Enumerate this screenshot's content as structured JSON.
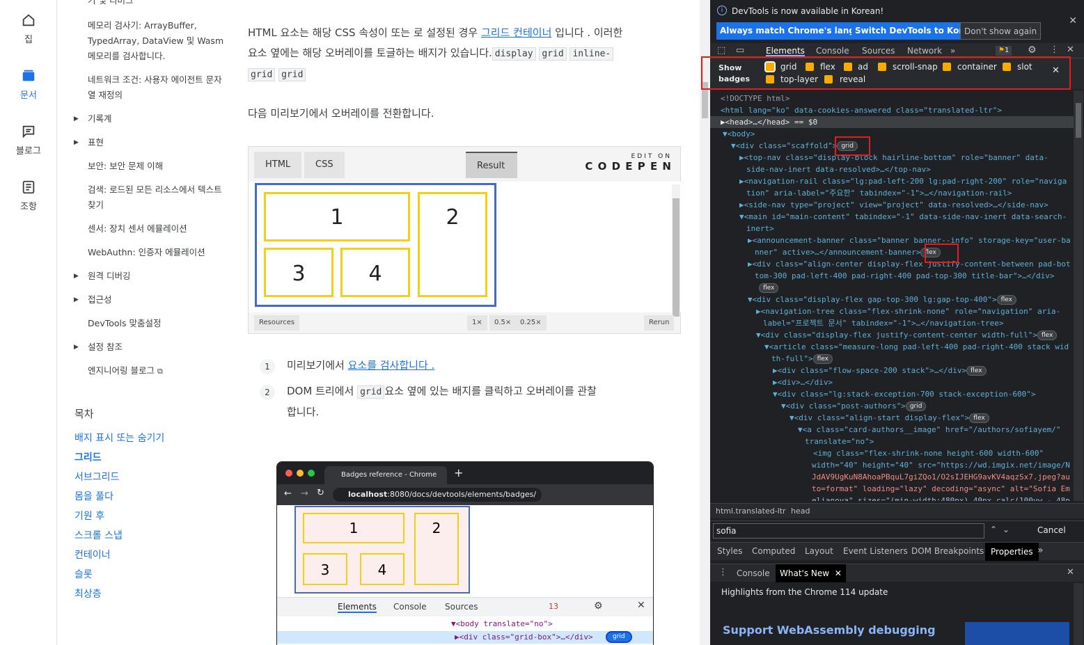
{
  "rail": [
    {
      "label": "집",
      "icon": "home-icon"
    },
    {
      "label": "문서",
      "icon": "docs-icon"
    },
    {
      "label": "블로그",
      "icon": "blog-icon"
    },
    {
      "label": "조항",
      "icon": "articles-icon"
    }
  ],
  "sidebar": {
    "items_top": [
      "기 및 디버그",
      "메모리 검사기: ArrayBuffer, TypedArray, DataView 및 Wasm 메모리를 검사합니다.",
      "네트워크 조건: 사용자 에이전트 문자열 재정의"
    ],
    "items": [
      {
        "label": "기록계",
        "caret": true
      },
      {
        "label": "표현",
        "caret": true
      },
      {
        "label": "보안: 보안 문제 이해",
        "caret": false
      },
      {
        "label": "검색: 로드된 모든 리소스에서 텍스트 찾기",
        "caret": false
      },
      {
        "label": "센서: 장치 센서 에뮬레이션",
        "caret": false
      },
      {
        "label": "WebAuthn: 인증자 에뮬레이션",
        "caret": false
      },
      {
        "label": "원격 디버깅",
        "caret": true
      },
      {
        "label": "접근성",
        "caret": true
      },
      {
        "label": "DevTools 맞춤설정",
        "caret": false
      },
      {
        "label": "설정 참조",
        "caret": true
      },
      {
        "label": "엔지니어링 블로그",
        "caret": false
      }
    ],
    "toc_title": "목차",
    "toc": [
      "배지 표시 또는 숨기기",
      "그리드",
      "서브그리드",
      "몸을 풀다",
      "기원 후",
      "스크롤 스냅",
      "컨테이너",
      "슬롯",
      "최상층"
    ]
  },
  "article": {
    "para1_a": "HTML 요소는 해당 CSS 속성이 또는 로 설정된 경우",
    "para1_link": "그리드 컨테이너",
    "para1_b": "입니다 . 이러한",
    "para2": "요소 옆에는 해당 오버레이를 토글하는 배지가 있습니다.",
    "code_display": "display",
    "code_grid": "grid",
    "code_inline": "inline-",
    "code_inline_grid": "grid",
    "code_grid2": "grid",
    "para3": "다음 미리보기에서 오버레이를 전환합니다.",
    "codepen": {
      "tab_html": "HTML",
      "tab_css": "CSS",
      "tab_result": "Result",
      "edit_on": "EDIT ON",
      "brand": "C O D E P E N",
      "cells": [
        "1",
        "2",
        "3",
        "4"
      ],
      "resources": "Resources",
      "zoom": [
        "1×",
        "0.5×",
        "0.25×"
      ],
      "rerun": "Rerun"
    },
    "step1_num": "1",
    "step1_a": "미리보기에서",
    "step1_link": "요소를 검사합니다 .",
    "step2_num": "2",
    "step2_a": "DOM 트리에서",
    "step2_code": "grid",
    "step2_b": "요소 옆에 있는 배지를 클릭하고 오버레이를 관찰",
    "step2_c": "합니다.",
    "shot": {
      "tab_title": "Badges reference - Chrome De",
      "url_host": "localhost",
      "url_rest": ":8080/docs/devtools/elements/badges/",
      "cells": [
        "1",
        "2",
        "3",
        "4"
      ],
      "dt_tabs": [
        "Elements",
        "Console",
        "Sources"
      ],
      "err_count": "13",
      "line1": "▼<body translate=\"no\">",
      "line2": "▶<div class=\"grid-box\">…</div>",
      "badge": "grid"
    }
  },
  "devtools": {
    "info": "DevTools is now available in Korean!",
    "btn_match": "Always match Chrome's language",
    "btn_switch": "Switch DevTools to Korean",
    "btn_dont": "Don't show again",
    "tabs": [
      "Elements",
      "Console",
      "Sources",
      "Network"
    ],
    "issues_count": "1",
    "show_badges": "Show badges",
    "badges": [
      "grid",
      "flex",
      "ad",
      "scroll-snap",
      "container",
      "slot",
      "top-layer",
      "reveal"
    ],
    "dom": [
      "<!DOCTYPE html>",
      "<html lang=\"ko\" data-cookies-answered class=\"translated-ltr\">",
      "▶<head>…</head> == $0",
      "▼<body>",
      "▼<div class=\"scaffold\">",
      "▶<top-nav class=\"display-block hairline-bottom\" role=\"banner\" data-",
      "side-nav-inert data-resolved>…</top-nav>",
      "▶<navigation-rail class=\"lg:pad-left-200 lg:pad-right-200\" role=\"naviga",
      "tion\" aria-label=\"주요한\" tabindex=\"-1\">…</navigation-rail>",
      "▶<side-nav type=\"project\" view=\"project\" data-resolved>…</side-nav>",
      "▼<main id=\"main-content\" tabindex=\"-1\" data-side-nav-inert data-search-",
      "inert>",
      "▶<announcement-banner class=\"banner banner--info\" storage-key=\"user-ba",
      "nner\" active>…</announcement-banner>",
      "▶<div class=\"align-center display-flex justify-content-between pad-bot",
      "tom-300 pad-left-400 pad-right-400 pad-top-300 title-bar\">…</div>",
      "",
      "▼<div class=\"display-flex gap-top-300 lg:gap-top-400\">",
      "▶<navigation-tree class=\"flex-shrink-none\" role=\"navigation\" aria-",
      "label=\"프로젝트 문서\" tabindex=\"-1\">…</navigation-tree>",
      "▼<div class=\"display-flex justify-content-center width-full\">",
      "▼<article class=\"measure-long pad-left-400 pad-right-400 stack wid",
      "th-full\">",
      "▶<div class=\"flow-space-200 stack\">…</div>",
      "▶<div>…</div>",
      "▼<div class=\"lg:stack-exception-700 stack-exception-600\">",
      "▼<div class=\"post-authors\">",
      "▼<div class=\"align-start display-flex\">",
      "▼<a class=\"card-authors__image\" href=\"/authors/sofiayem/\"",
      "translate=\"no\">",
      "<img class=\"flex-shrink-none height-600 width-600\"",
      "width=\"40\" height=\"40\" src=\"https://wd.imgix.net/image/N",
      "JdAV9UgKuN8AhoaPBquL7giZQo1/O2sIJEHG9avKV4aqzSx7.jpeg?au",
      "to=format\" loading=\"lazy\" decoding=\"async\" alt=\"Sofia Em",
      "elianova\" sizes=\"(min-width:480px) 40px,calc(100vw - 48p"
    ],
    "breadcrumb": [
      "html.translated-ltr",
      "head"
    ],
    "search_value": "sofia",
    "cancel": "Cancel",
    "panel_tabs": [
      "Styles",
      "Computed",
      "Layout",
      "Event Listeners",
      "DOM Breakpoints",
      "Properties"
    ],
    "drawer_tabs": [
      "Console",
      "What's New"
    ],
    "highlights": "Highlights from the Chrome 114 update",
    "wasm": "Support WebAssembly debugging"
  },
  "colors": {
    "accent": "#1a73e8",
    "highlight_red": "#e41d1d",
    "grid_blue": "#4469cc",
    "grid_yellow": "#f4cf19",
    "badge_checkbox": "#f9ab00"
  }
}
